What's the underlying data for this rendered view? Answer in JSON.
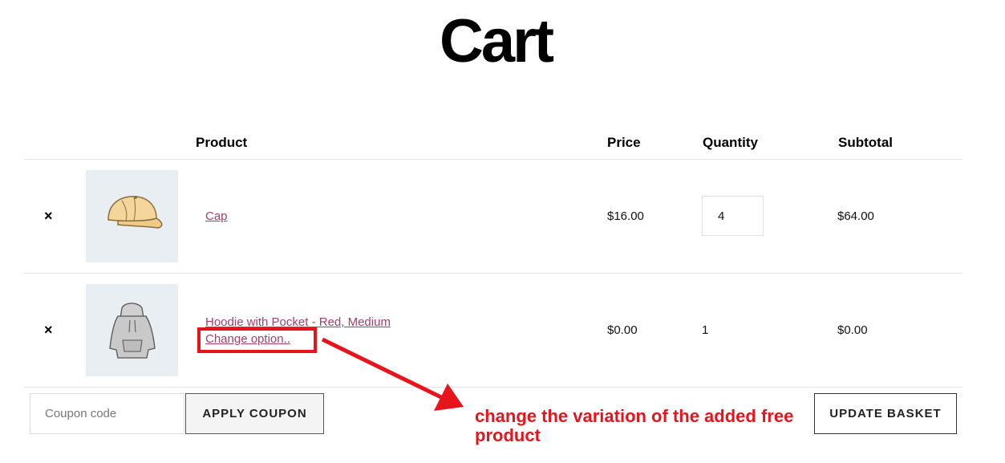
{
  "page": {
    "title": "Cart"
  },
  "table": {
    "headers": {
      "product": "Product",
      "price": "Price",
      "quantity": "Quantity",
      "subtotal": "Subtotal"
    },
    "rows": [
      {
        "remove": "×",
        "name": "Cap",
        "price": "$16.00",
        "quantity": "4",
        "subtotal": "$64.00"
      },
      {
        "remove": "×",
        "name": "Hoodie with Pocket - Red, Medium",
        "change_option": "Change option..",
        "price": "$0.00",
        "quantity": "1",
        "subtotal": "$0.00"
      }
    ]
  },
  "actions": {
    "coupon_placeholder": "Coupon code",
    "apply_coupon": "APPLY COUPON",
    "update_basket": "UPDATE BASKET"
  },
  "annotation": {
    "text": "change the variation of the added free product",
    "color": "#e8141c"
  },
  "colors": {
    "link": "#a3406a",
    "thumb_bg": "#e9eef3"
  }
}
